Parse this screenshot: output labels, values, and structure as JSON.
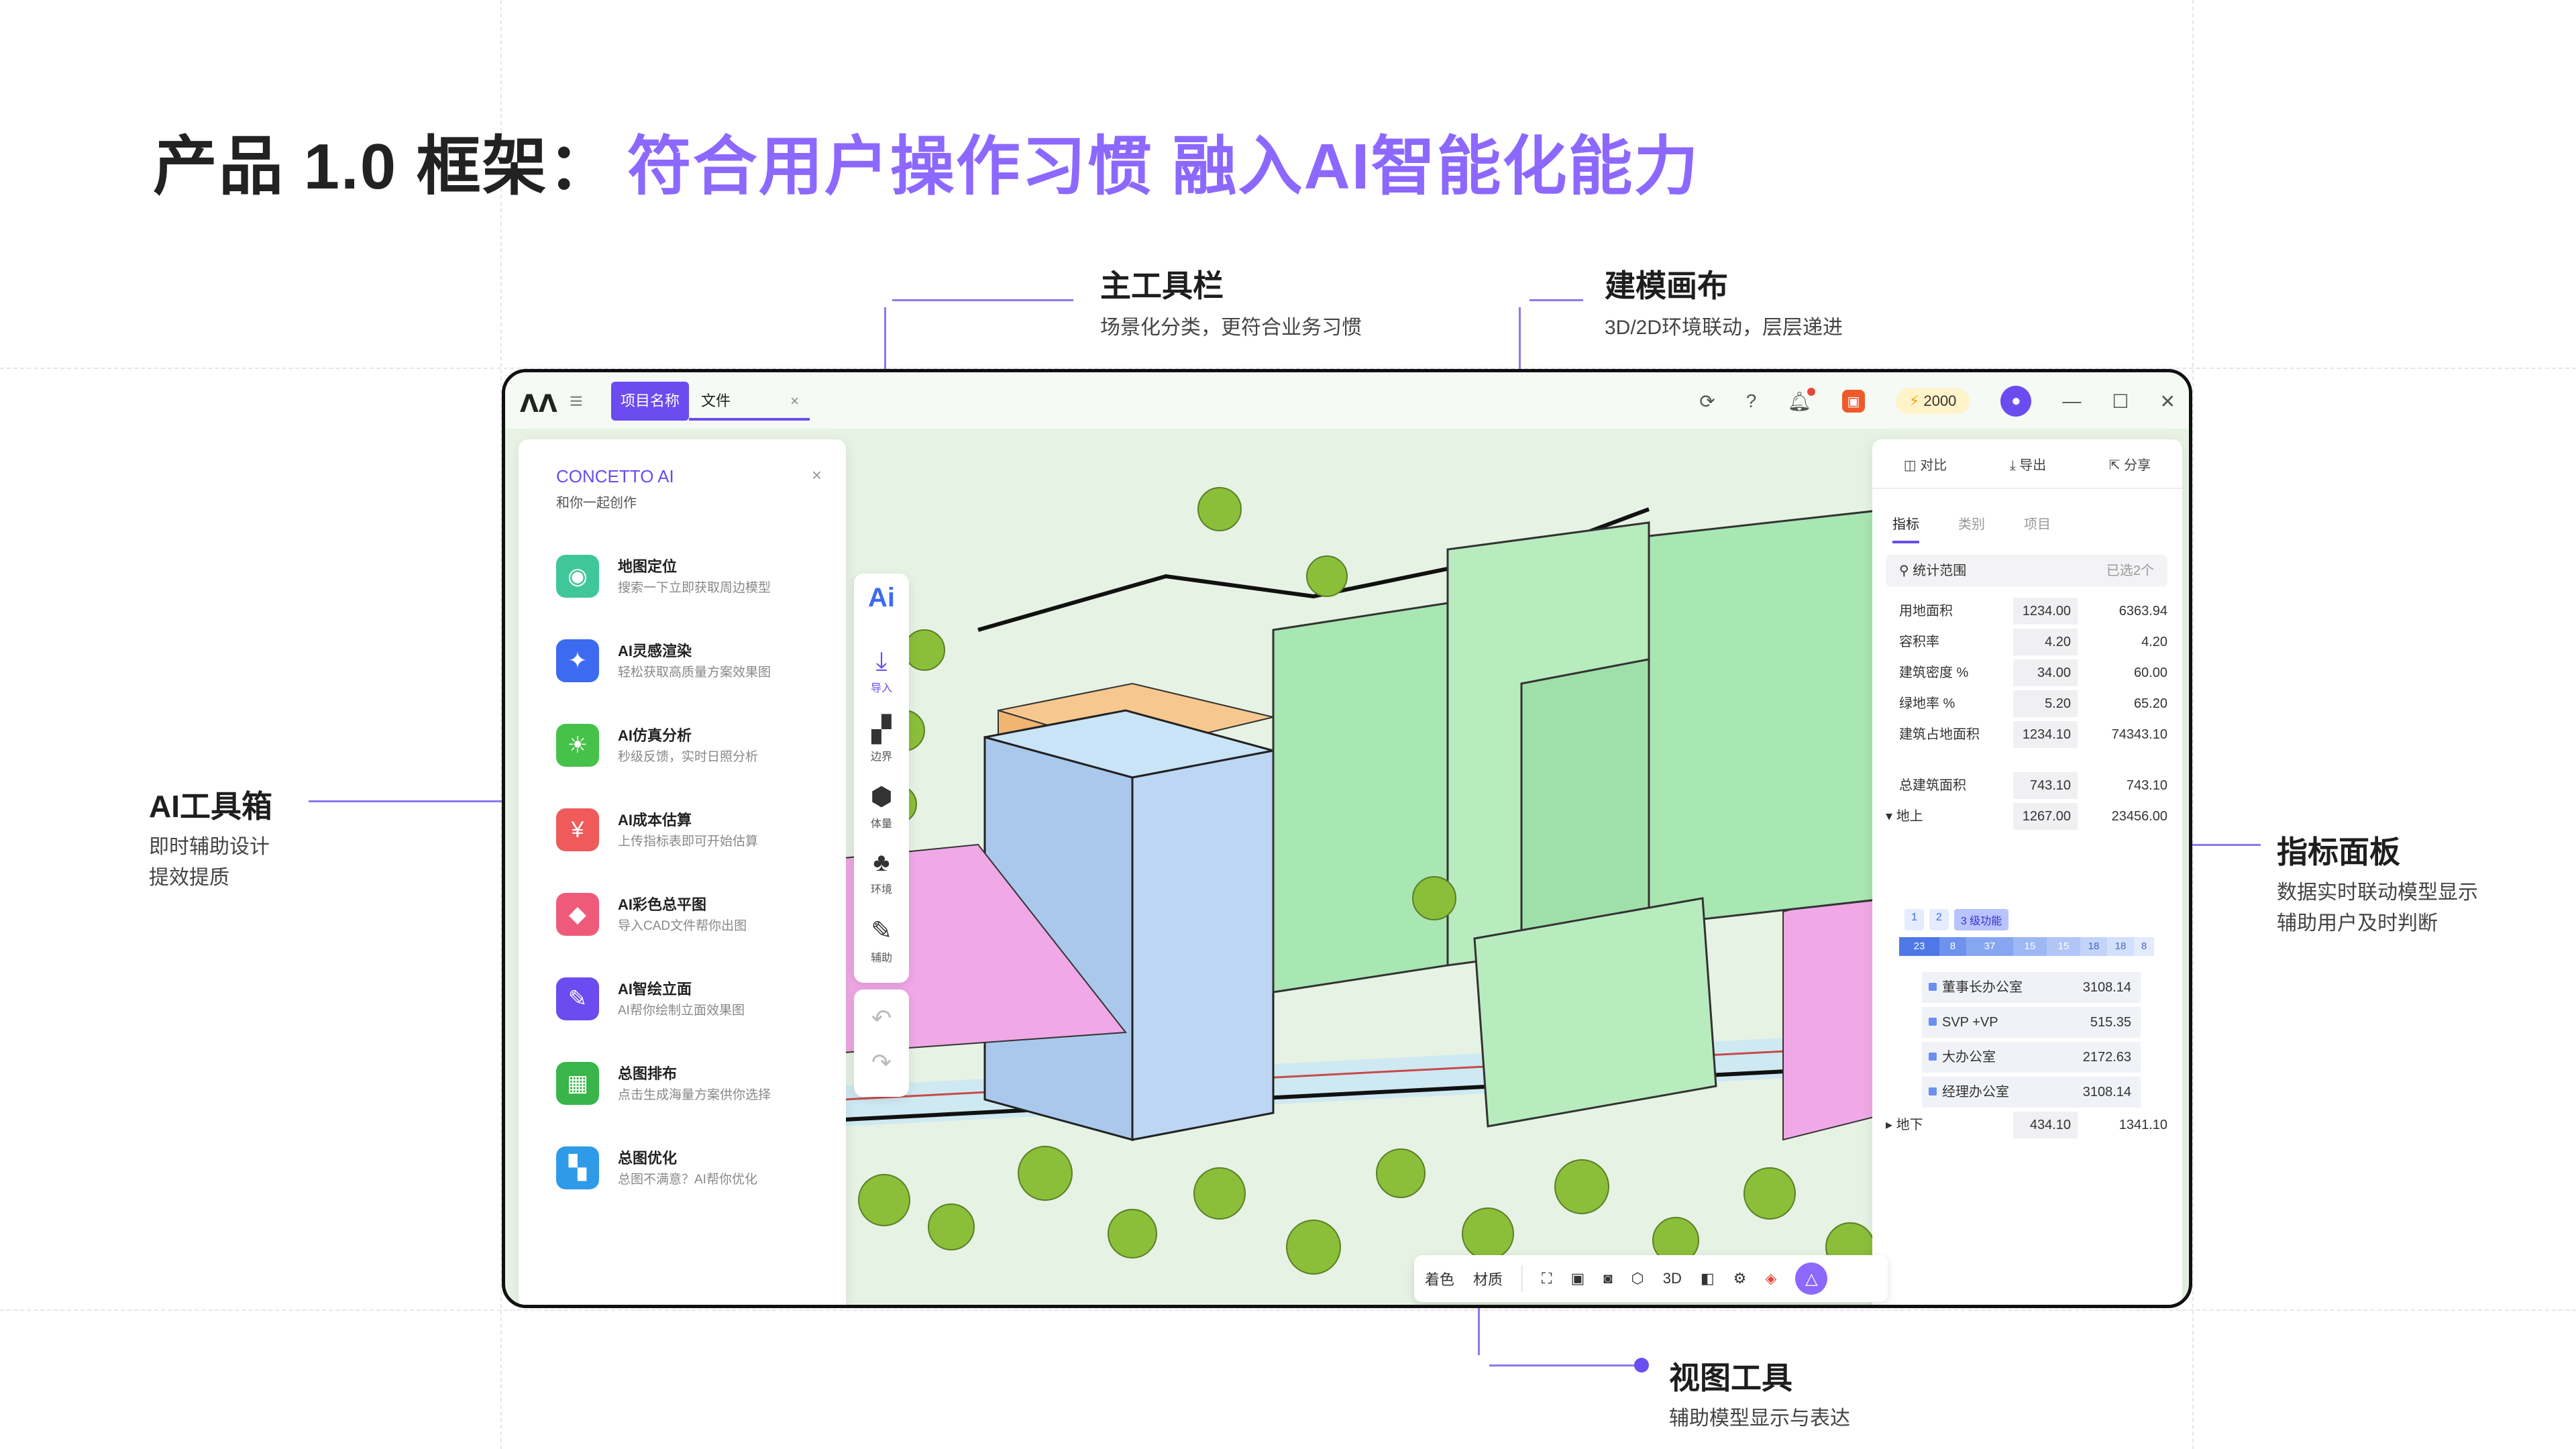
{
  "title": {
    "prefix": "产品 1.0 框架：",
    "highlight": "符合用户操作习惯  融入AI智能化能力"
  },
  "annotations": {
    "toolbar": {
      "title": "主工具栏",
      "sub": "场景化分类，更符合业务习惯"
    },
    "canvas": {
      "title": "建模画布",
      "sub": "3D/2D环境联动，层层递进"
    },
    "ai_box": {
      "title": "AI工具箱",
      "sub1": "即时辅助设计",
      "sub2": "提效提质"
    },
    "metrics": {
      "title": "指标面板",
      "sub1": "数据实时联动模型显示",
      "sub2": "辅助用户及时判断"
    },
    "view": {
      "title": "视图工具",
      "sub": "辅助模型显示与表达"
    }
  },
  "window": {
    "logo": "ᐱᐱ",
    "menu_icon": "menu-icon",
    "tab_project": "项目名称",
    "tab_file": "文件",
    "tab_close": "×",
    "credit": "2000",
    "avatar": "👤",
    "win_min": "—",
    "win_max": "☐",
    "win_close": "✕"
  },
  "ai_panel": {
    "title": "CONCETTO AI",
    "subtitle": "和你一起创作",
    "close": "×",
    "items": [
      {
        "name": "地图定位",
        "desc": "搜索一下立即获取周边模型",
        "color": "#3fc79a",
        "icon": "map-pin-icon"
      },
      {
        "name": "AI灵感渲染",
        "desc": "轻松获取高质量方案效果图",
        "color": "#3d6bf0",
        "icon": "sparkle-icon"
      },
      {
        "name": "AI仿真分析",
        "desc": "秒级反馈，实时日照分析",
        "color": "#46c24a",
        "icon": "sun-icon"
      },
      {
        "name": "AI成本估算",
        "desc": "上传指标表即可开始估算",
        "color": "#ef5a5a",
        "icon": "coin-icon"
      },
      {
        "name": "AI彩色总平图",
        "desc": "导入CAD文件帮你出图",
        "color": "#f05a7a",
        "icon": "palette-icon"
      },
      {
        "name": "AI智绘立面",
        "desc": "AI帮你绘制立面效果图",
        "color": "#6a4cf0",
        "icon": "brush-icon"
      },
      {
        "name": "总图排布",
        "desc": "点击生成海量方案供你选择",
        "color": "#39b54a",
        "icon": "grid-icon"
      },
      {
        "name": "总图优化",
        "desc": "总图不满意？AI帮你优化",
        "color": "#2f9be8",
        "icon": "layout-icon"
      }
    ]
  },
  "main_toolbar": {
    "ai": "Ai",
    "items": [
      {
        "label": "导入",
        "icon": "import-icon"
      },
      {
        "label": "边界",
        "icon": "boundary-icon"
      },
      {
        "label": "体量",
        "icon": "cube-icon"
      },
      {
        "label": "环境",
        "icon": "tree-icon"
      },
      {
        "label": "辅助",
        "icon": "pen-icon"
      }
    ]
  },
  "metrics_panel": {
    "actions": [
      "对比",
      "导出",
      "分享"
    ],
    "tabs": [
      "指标",
      "类别",
      "项目"
    ],
    "scope_label": "统计范围",
    "scope_value": "已选2个",
    "rows": [
      {
        "name": "用地面积",
        "v1": "1234.00",
        "v2": "6363.94"
      },
      {
        "name": "容积率",
        "v1": "4.20",
        "v2": "4.20"
      },
      {
        "name": "建筑密度 %",
        "v1": "34.00",
        "v2": "60.00"
      },
      {
        "name": "绿地率 %",
        "v1": "5.20",
        "v2": "65.20"
      },
      {
        "name": "建筑占地面积",
        "v1": "1234.10",
        "v2": "74343.10"
      },
      {
        "name": "总建筑面积",
        "v1": "743.10",
        "v2": "743.10"
      },
      {
        "name": "▾ 地上",
        "v1": "1267.00",
        "v2": "23456.00"
      }
    ],
    "levels": [
      "1",
      "2",
      "3 级功能"
    ],
    "bar_segments": [
      "23",
      "8",
      "37",
      "15",
      "15",
      "18",
      "18",
      "8"
    ],
    "functions": [
      {
        "name": "董事长办公室",
        "value": "3108.14"
      },
      {
        "name": "SVP +VP",
        "value": "515.35"
      },
      {
        "name": "大办公室",
        "value": "2172.63"
      },
      {
        "name": "经理办公室",
        "value": "3108.14"
      }
    ],
    "basement": {
      "name": "▸ 地下",
      "v1": "434.10",
      "v2": "1341.10"
    }
  },
  "view_bar": {
    "color_label": "着色",
    "material_label": "材质",
    "mode_3d": "3D"
  }
}
